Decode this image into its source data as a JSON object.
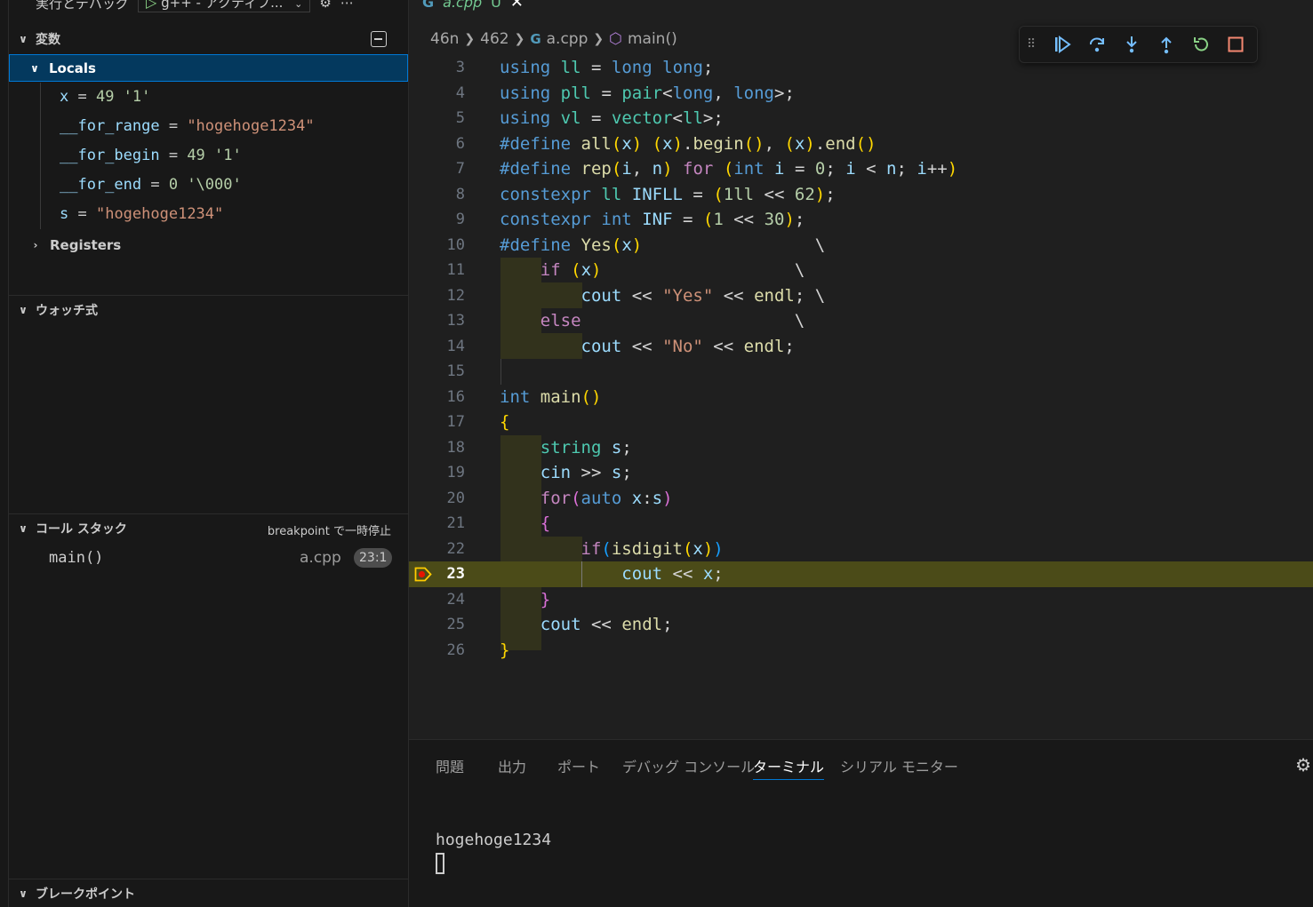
{
  "topbar": {
    "title": "実行とデバッグ",
    "config": "g++ - アクティブ..."
  },
  "sections": {
    "variables": "変数",
    "watch": "ウォッチ式",
    "callstack": "コール スタック",
    "breakpoints": "ブレークポイント"
  },
  "variables": {
    "locals_label": "Locals",
    "registers_label": "Registers",
    "items": [
      {
        "name": "x",
        "value": "49 '1'"
      },
      {
        "name": "__for_range",
        "value": "\"hogehoge1234\""
      },
      {
        "name": "__for_begin",
        "value": "49 '1'"
      },
      {
        "name": "__for_end",
        "value": "0 '\\000'"
      },
      {
        "name": "s",
        "value": "\"hogehoge1234\""
      }
    ]
  },
  "callstack": {
    "status": "breakpoint で一時停止",
    "frames": [
      {
        "fn": "main()",
        "file": "a.cpp",
        "pos": "23:1"
      }
    ]
  },
  "editor": {
    "tab_name": "a.cpp",
    "tab_mod": "U",
    "breadcrumb": [
      "46n",
      "462",
      "a.cpp",
      "main()"
    ],
    "current_line": 23,
    "line_numbers": [
      "3",
      "4",
      "5",
      "6",
      "7",
      "8",
      "9",
      "10",
      "11",
      "12",
      "13",
      "14",
      "15",
      "16",
      "17",
      "18",
      "19",
      "20",
      "21",
      "22",
      "23",
      "24",
      "25",
      "26"
    ]
  },
  "panel": {
    "tabs": [
      "問題",
      "出力",
      "ポート",
      "デバッグ コンソール",
      "ターミナル",
      "シリアル モニター"
    ],
    "active_tab": "ターミナル",
    "terminal_output": "hogehoge1234"
  },
  "colors": {
    "accent": "#0078d4",
    "current_line_bg": "#4b4b18",
    "breakpoint": "#e51400",
    "stop": "#f48771",
    "continue": "#75beff",
    "restart": "#89d185"
  }
}
